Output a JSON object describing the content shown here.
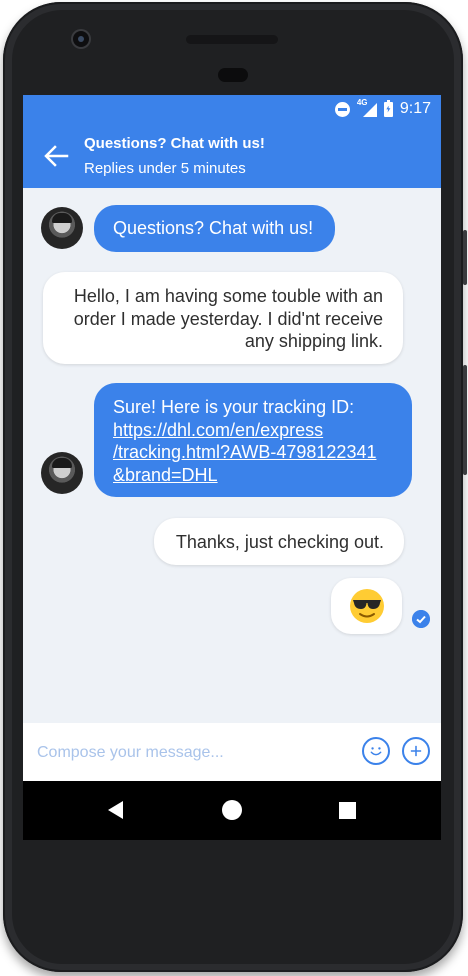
{
  "status_bar": {
    "network": "4G",
    "time": "9:17"
  },
  "header": {
    "title": "Questions? Chat with us!",
    "subtitle": "Replies under 5 minutes",
    "back_icon": "arrow-left-icon"
  },
  "messages": [
    {
      "sender": "agent",
      "lines": [
        "Questions? Chat with us!"
      ]
    },
    {
      "sender": "user",
      "lines": [
        "Hello, I am having some touble with an",
        "order I made yesterday. I did'nt receive",
        "any shipping link."
      ]
    },
    {
      "sender": "agent",
      "intro": "Sure! Here is your tracking ID:",
      "link_lines": [
        "https://dhl.com/en/express",
        "/tracking.html?AWB-4798122341",
        "&brand=DHL"
      ]
    },
    {
      "sender": "user",
      "lines": [
        "Thanks, just checking out."
      ]
    },
    {
      "sender": "user",
      "emoji": "smiling-face-with-sunglasses",
      "read": true
    }
  ],
  "composer": {
    "placeholder": "Compose your message...",
    "emoji_icon": "smiley-icon",
    "add_icon": "plus-icon"
  },
  "colors": {
    "accent": "#3b82ea",
    "background": "#eef2f7"
  }
}
